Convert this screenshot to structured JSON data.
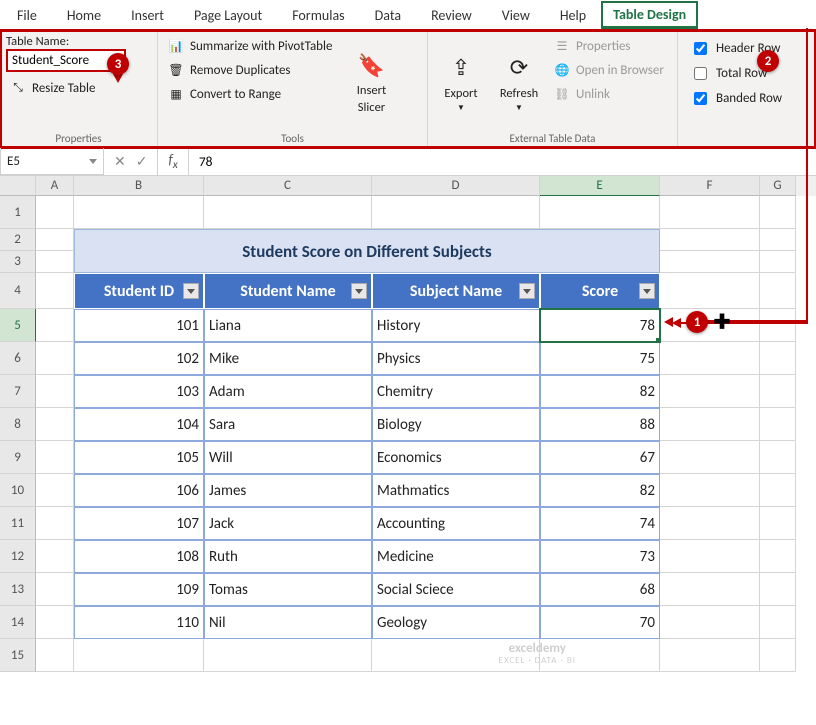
{
  "tabs": {
    "file": "File",
    "home": "Home",
    "insert": "Insert",
    "page_layout": "Page Layout",
    "formulas": "Formulas",
    "data": "Data",
    "review": "Review",
    "view": "View",
    "help": "Help",
    "table_design": "Table Design"
  },
  "ribbon": {
    "properties": {
      "table_name_label": "Table Name:",
      "table_name_value": "Student_Score",
      "resize_table": "Resize Table",
      "group_label": "Properties"
    },
    "tools": {
      "pivot": "Summarize with PivotTable",
      "dup": "Remove Duplicates",
      "range": "Convert to Range",
      "slicer_top": "Insert",
      "slicer_bot": "Slicer",
      "group_label": "Tools"
    },
    "external": {
      "export": "Export",
      "refresh": "Refresh",
      "props": "Properties",
      "browser": "Open in Browser",
      "unlink": "Unlink",
      "group_label": "External Table Data"
    },
    "options": {
      "header_row": "Header Row",
      "total_row": "Total Row",
      "banded_row": "Banded Row"
    }
  },
  "formula_bar": {
    "name_box": "E5",
    "formula": "78"
  },
  "columns": [
    "A",
    "B",
    "C",
    "D",
    "E",
    "F",
    "G"
  ],
  "row_numbers": [
    "1",
    "2",
    "3",
    "4",
    "5",
    "6",
    "7",
    "8",
    "9",
    "10",
    "11",
    "12",
    "13",
    "14",
    "15"
  ],
  "sheet": {
    "title": "Student Score on Different Subjects",
    "headers": {
      "id": "Student ID",
      "name": "Student Name",
      "subject": "Subject Name",
      "score": "Score"
    },
    "rows": [
      {
        "id": "101",
        "name": "Liana",
        "subject": "History",
        "score": "78"
      },
      {
        "id": "102",
        "name": "Mike",
        "subject": "Physics",
        "score": "75"
      },
      {
        "id": "103",
        "name": "Adam",
        "subject": "Chemitry",
        "score": "82"
      },
      {
        "id": "104",
        "name": "Sara",
        "subject": "Biology",
        "score": "88"
      },
      {
        "id": "105",
        "name": "Will",
        "subject": "Economics",
        "score": "67"
      },
      {
        "id": "106",
        "name": "James",
        "subject": "Mathmatics",
        "score": "82"
      },
      {
        "id": "107",
        "name": "Jack",
        "subject": "Accounting",
        "score": "74"
      },
      {
        "id": "108",
        "name": "Ruth",
        "subject": "Medicine",
        "score": "73"
      },
      {
        "id": "109",
        "name": "Tomas",
        "subject": "Social Sciece",
        "score": "68"
      },
      {
        "id": "110",
        "name": "Nil",
        "subject": "Geology",
        "score": "70"
      }
    ]
  },
  "badges": {
    "b1": "1",
    "b2": "2",
    "b3": "3"
  },
  "watermark": {
    "line1": "exceldemy",
    "line2": "EXCEL · DATA · BI"
  }
}
